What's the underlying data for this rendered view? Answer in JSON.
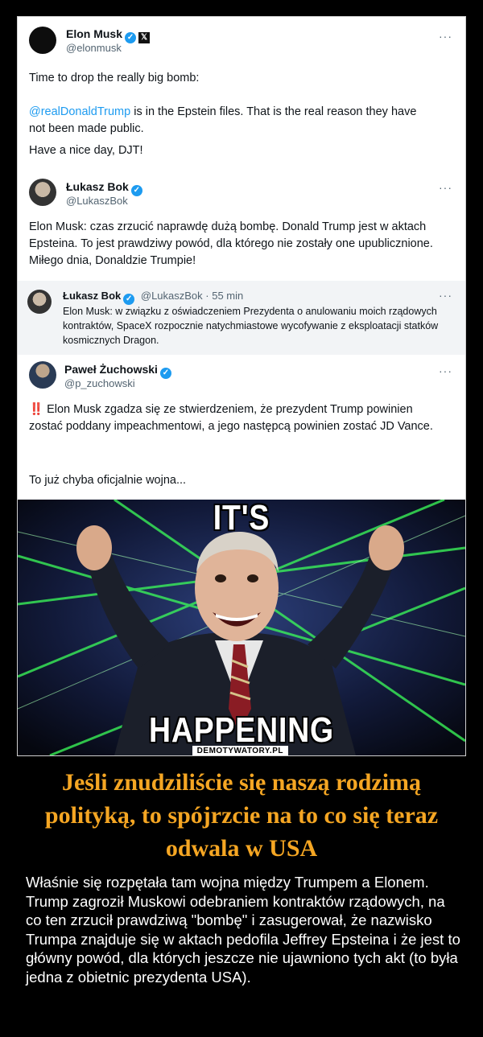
{
  "tweet1": {
    "name": "Elon Musk",
    "handle": "@elonmusk",
    "more": "···",
    "line1": "Time to drop the really big bomb:",
    "mention": "@realDonaldTrump",
    "line2_rest": " is in the Epstein files. That is the real reason they have not been made public.",
    "line3": "Have a nice day, DJT!"
  },
  "tweet2": {
    "name": "Łukasz Bok",
    "handle": "@LukaszBok",
    "more": "···",
    "body": "Elon Musk: czas zrzucić naprawdę dużą bombę. Donald Trump jest w aktach Epsteina. To jest prawdziwy powód, dla którego nie zostały one upublicznione. Miłego dnia, Donaldzie Trumpie!"
  },
  "quote": {
    "name": "Łukasz Bok",
    "meta": "@LukaszBok · 55 min",
    "more": "···",
    "body": "Elon Musk: w związku z oświadczeniem Prezydenta o anulowaniu moich rządowych kontraktów, SpaceX rozpocznie natychmiastowe wycofywanie z eksploatacji statków kosmicznych Dragon."
  },
  "tweet3": {
    "name": "Paweł Żuchowski",
    "handle": "@p_zuchowski",
    "more": "···",
    "mark": "‼️",
    "body": " Elon Musk zgadza się ze stwierdzeniem, że prezydent Trump powinien zostać poddany impeachmentowi, a jego następcą powinien zostać JD Vance.",
    "line2": "To już chyba oficjalnie wojna..."
  },
  "meme": {
    "top": "IT'S",
    "bottom": "HAPPENING",
    "watermark": "DEMOTYWATORY.PL"
  },
  "headline": "Jeśli znudziliście się naszą rodzimą polityką, to spójrzcie na to co się teraz odwala w USA",
  "description": "Właśnie się rozpętała tam wojna między Trumpem a Elonem. Trump zagroził Muskowi odebraniem kontraktów rządowych, na co ten zrzucił prawdziwą \"bombę\" i zasugerował, że nazwisko Trumpa znajduje się w aktach pedofila Jeffrey Epsteina i że jest to główny powód, dla których jeszcze nie ujawniono tych akt (to była jedna z obietnic prezydenta USA).",
  "colors": {
    "headline": "#f5a623",
    "link": "#1d9bf0",
    "background": "#000000"
  }
}
